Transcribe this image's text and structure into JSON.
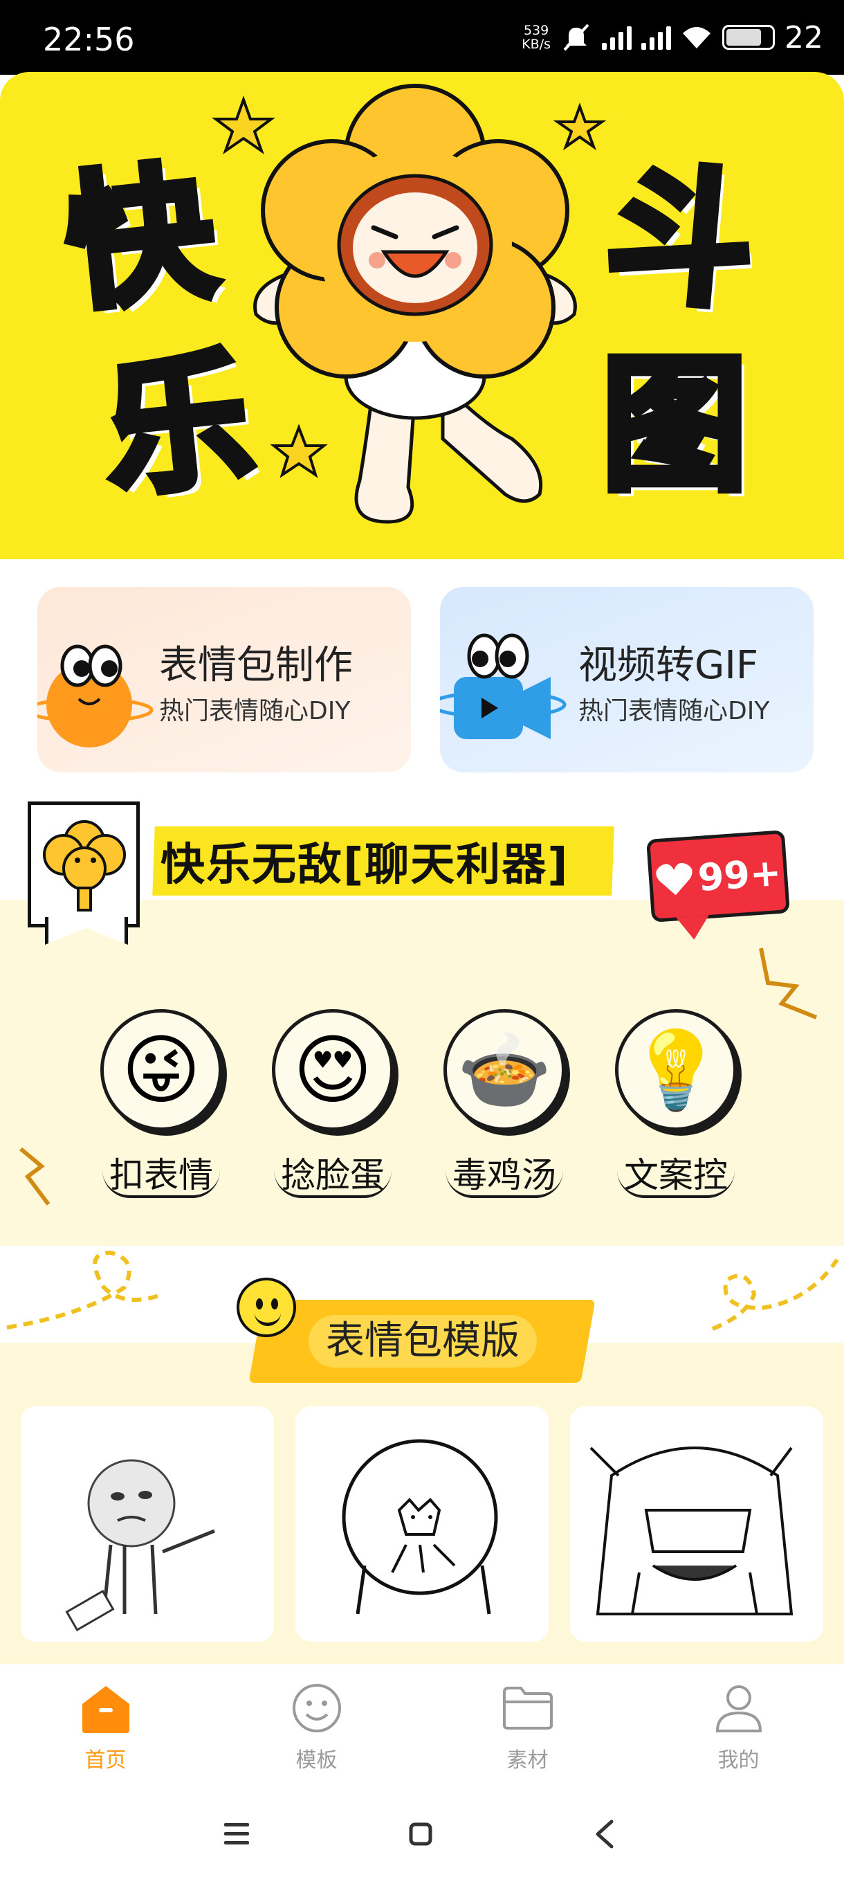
{
  "status_bar": {
    "time": "22:56",
    "net_speed_value": "539",
    "net_speed_unit": "KB/s",
    "battery": "22"
  },
  "banner": {
    "chars": [
      "快",
      "乐",
      "斗",
      "图"
    ]
  },
  "feature_cards": [
    {
      "title": "表情包制作",
      "subtitle": "热门表情随心DIY",
      "icon": "planet-mascot-icon"
    },
    {
      "title": "视频转GIF",
      "subtitle": "热门表情随心DIY",
      "icon": "video-camera-mascot-icon"
    }
  ],
  "chat_section": {
    "title": "快乐无敌[聊天利器]",
    "likes": "99+",
    "categories": [
      {
        "label": "扣表情",
        "icon": "tongue-out-emoji-icon"
      },
      {
        "label": "捻脸蛋",
        "icon": "heart-eyes-face-icon"
      },
      {
        "label": "毒鸡汤",
        "icon": "soup-bowl-icon"
      },
      {
        "label": "文案控",
        "icon": "lightbulb-icon"
      }
    ]
  },
  "template_section": {
    "title": "表情包模版",
    "items": [
      {
        "icon": "meme-pointing-guy-icon"
      },
      {
        "icon": "meme-cat-face-icon"
      },
      {
        "icon": "meme-anime-facepalm-icon"
      }
    ]
  },
  "bottom_nav": {
    "items": [
      {
        "label": "首页",
        "icon": "home-icon",
        "active": true
      },
      {
        "label": "模板",
        "icon": "smiley-icon",
        "active": false
      },
      {
        "label": "素材",
        "icon": "folder-icon",
        "active": false
      },
      {
        "label": "我的",
        "icon": "user-icon",
        "active": false
      }
    ]
  },
  "colors": {
    "banner_yellow": "#fbea1d",
    "accent_orange": "#ff9a12",
    "badge_red": "#f0313d",
    "section_cream": "#fff9dc"
  }
}
